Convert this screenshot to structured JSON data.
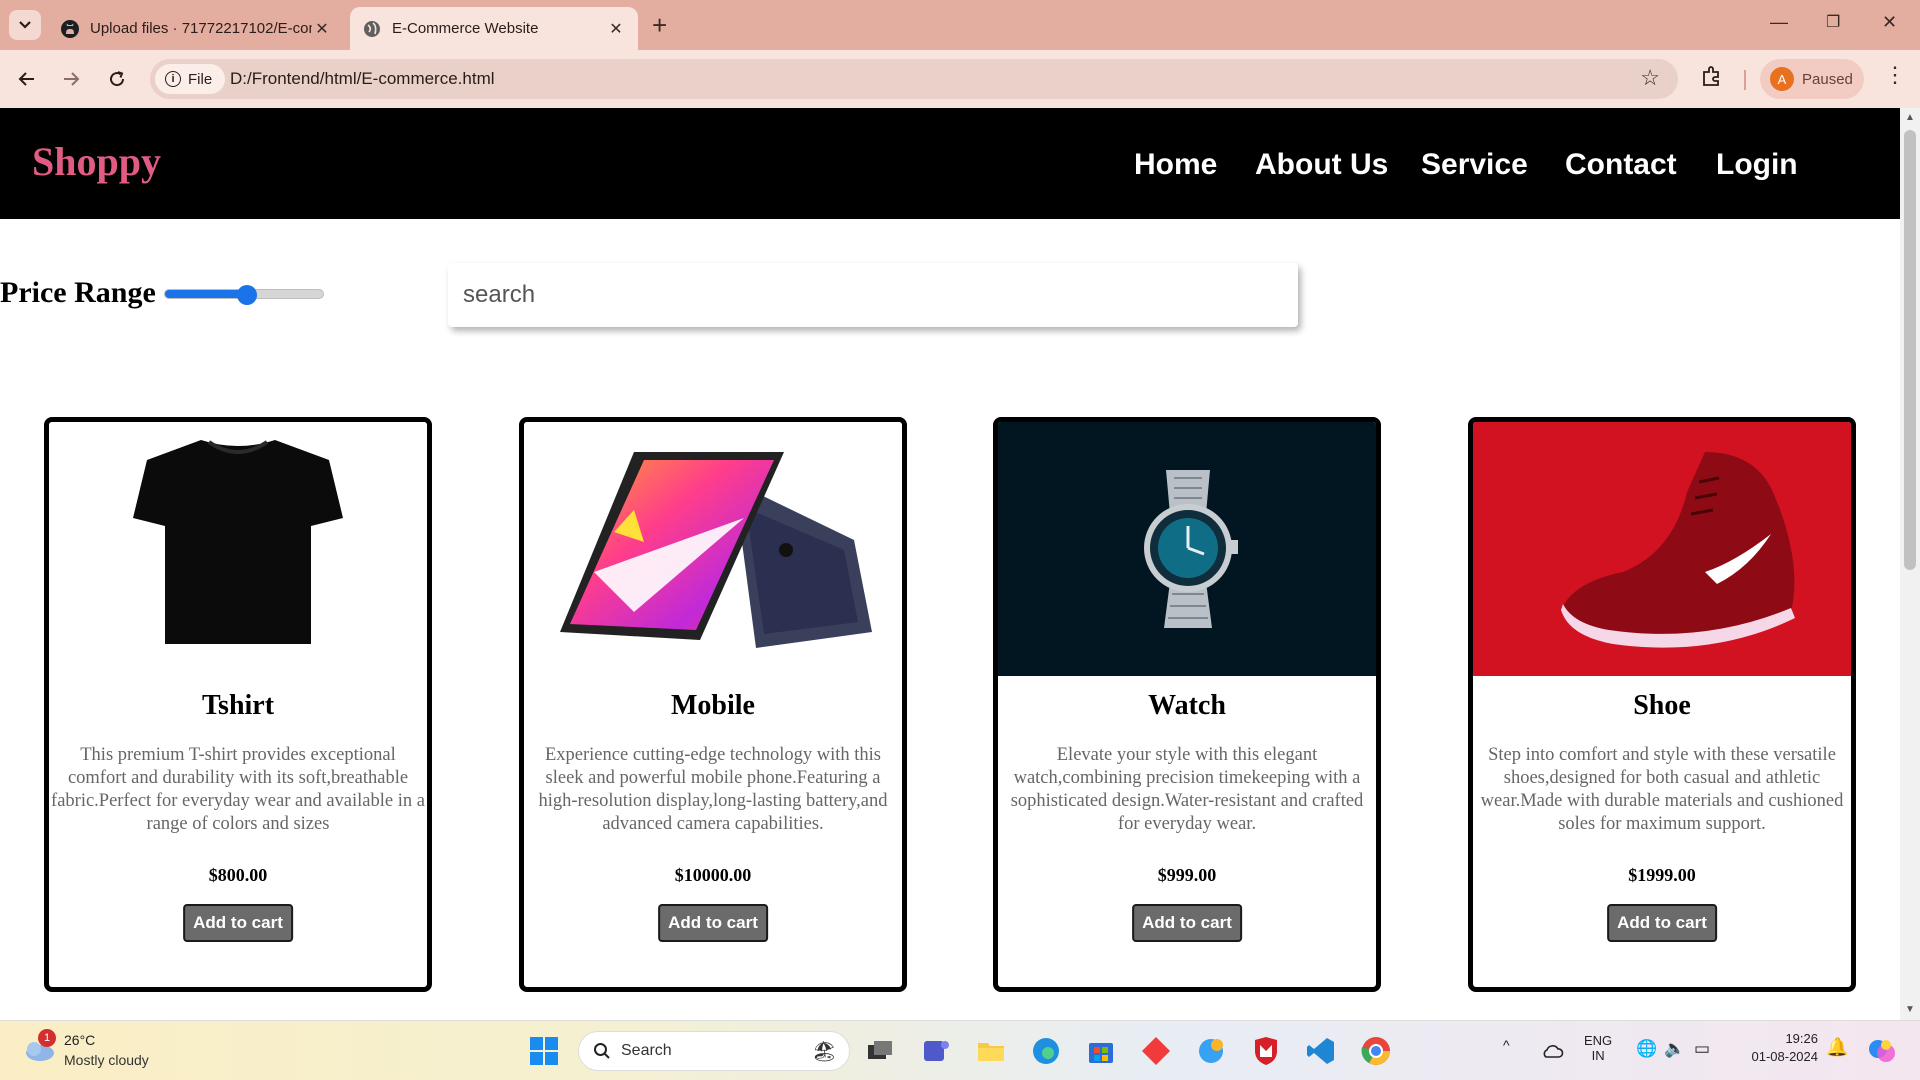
{
  "browser": {
    "tabs": [
      {
        "title": "Upload files · 71772217102/E-commerce",
        "active": false,
        "icon": "github-icon"
      },
      {
        "title": "E-Commerce Website",
        "active": true,
        "icon": "globe-icon"
      }
    ],
    "url_scheme_label": "File",
    "url": "D:/Frontend/html/E-commerce.html",
    "profile_initial": "A",
    "profile_status": "Paused"
  },
  "site": {
    "logo": "Shoppy",
    "nav": [
      "Home",
      "About Us",
      "Service",
      "Contact",
      "Login"
    ],
    "price_range_label": "Price Range",
    "price_range_value": 0.52,
    "search_placeholder": "search"
  },
  "products": [
    {
      "title": "Tshirt",
      "description": "This premium T-shirt provides exceptional comfort and durability with its soft,breathable fabric.Perfect for everyday wear and available in a range of colors and sizes",
      "price": "$800.00",
      "button": "Add to cart",
      "image": "tshirt-image"
    },
    {
      "title": "Mobile",
      "description": "Experience cutting-edge technology with this sleek and powerful mobile phone.Featuring a high-resolution display,long-lasting battery,and advanced camera capabilities.",
      "price": "$10000.00",
      "button": "Add to cart",
      "image": "phone-image"
    },
    {
      "title": "Watch",
      "description": "Elevate your style with this elegant watch,combining precision timekeeping with a sophisticated design.Water-resistant and crafted for everyday wear.",
      "price": "$999.00",
      "button": "Add to cart",
      "image": "watch-image"
    },
    {
      "title": "Shoe",
      "description": "Step into comfort and style with these versatile shoes,designed for both casual and athletic wear.Made with durable materials and cushioned soles for maximum support.",
      "price": "$1999.00",
      "button": "Add to cart",
      "image": "shoe-image"
    }
  ],
  "taskbar": {
    "weather_temp": "26°C",
    "weather_desc": "Mostly cloudy",
    "weather_badge": "1",
    "search_label": "Search",
    "lang_top": "ENG",
    "lang_bottom": "IN",
    "time": "19:26",
    "date": "01-08-2024"
  },
  "colors": {
    "tabstrip": "#e3ada0",
    "toolbar": "#f8e3dd",
    "logo": "#e15b83",
    "nav_bg": "#000000",
    "slider": "#1a73e8",
    "button_bg": "#6b6b6b"
  }
}
